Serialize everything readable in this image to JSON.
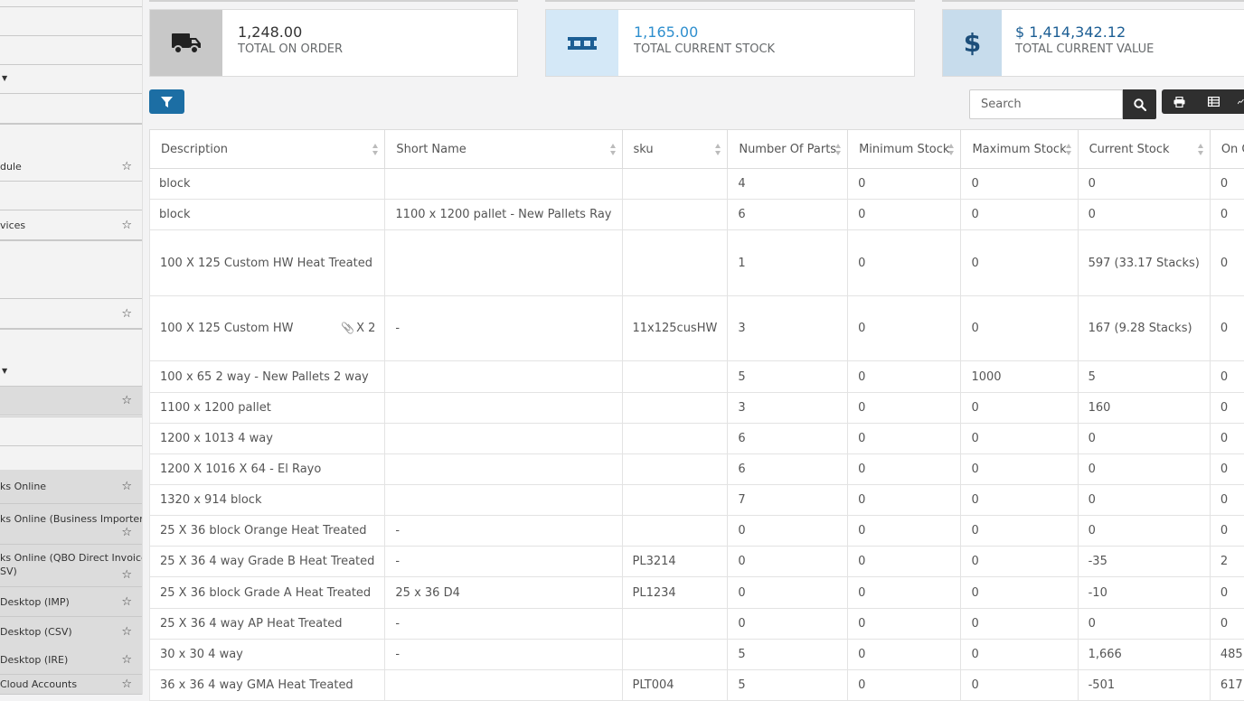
{
  "sidebar": {
    "items": [
      {
        "label": "",
        "star": false,
        "caret": false,
        "dark": false
      },
      {
        "label": "",
        "star": false,
        "caret": false,
        "dark": false
      },
      {
        "label": "",
        "star": false,
        "caret": false,
        "dark": false
      },
      {
        "label": "",
        "star": false,
        "caret": true,
        "dark": false
      },
      {
        "label": "",
        "star": false,
        "caret": false,
        "dark": false
      },
      {
        "label": "dule",
        "star": true,
        "caret": false,
        "dark": false
      },
      {
        "label": "",
        "star": false,
        "caret": false,
        "dark": false
      },
      {
        "label": "vices",
        "star": true,
        "caret": false,
        "dark": false
      },
      {
        "label": "",
        "star": false,
        "caret": false,
        "dark": false
      },
      {
        "label": "",
        "star": true,
        "caret": false,
        "dark": false
      },
      {
        "label": "",
        "star": false,
        "caret": true,
        "dark": false
      },
      {
        "label": "",
        "star": true,
        "caret": false,
        "dark": true
      },
      {
        "label": "ks Online",
        "star": true,
        "caret": false,
        "dark": true
      },
      {
        "label": "ks Online (Business Importer -",
        "star": true,
        "caret": false,
        "dark": true
      },
      {
        "label": "ks Online (QBO Direct Invoice",
        "label2": "SV)",
        "star": true,
        "caret": false,
        "dark": true
      },
      {
        "label": "Desktop (IMP)",
        "star": true,
        "caret": false,
        "dark": true
      },
      {
        "label": "Desktop (CSV)",
        "star": true,
        "caret": false,
        "dark": true
      },
      {
        "label": "Desktop (IRE)",
        "star": true,
        "caret": false,
        "dark": true
      },
      {
        "label": "Cloud Accounts",
        "star": true,
        "caret": false,
        "dark": true
      }
    ]
  },
  "cards": [
    {
      "value": "1,248.00",
      "label": "TOTAL ON ORDER",
      "icon": "truck-icon",
      "value_color": "#333333",
      "icon_bg": "#c8c8c8"
    },
    {
      "value": "1,165.00",
      "label": "TOTAL CURRENT STOCK",
      "icon": "pallet-icon",
      "value_color": "#2f8fce",
      "icon_bg": "#d4e8f7"
    },
    {
      "value": "$ 1,414,342.12",
      "label": "TOTAL CURRENT VALUE",
      "icon": "dollar-icon",
      "value_color": "#1c5e94",
      "icon_bg": "#c7dcec"
    }
  ],
  "toolbar": {
    "search_placeholder": "Search"
  },
  "table": {
    "columns": [
      "Description",
      "Short Name",
      "sku",
      "Number Of Parts",
      "Minimum Stock",
      "Maximum Stock",
      "Current Stock",
      "On Order"
    ],
    "rows": [
      {
        "description": "block",
        "short_name": "",
        "sku": "",
        "parts": "4",
        "min": "0",
        "max": "0",
        "current": "0",
        "on_order": "0"
      },
      {
        "description": "block",
        "short_name": "1100 x 1200 pallet - New Pallets Ray",
        "sku": "",
        "parts": "6",
        "min": "0",
        "max": "0",
        "current": "0",
        "on_order": "0"
      },
      {
        "description": "100 X 125 Custom HW Heat Treated",
        "short_name": "",
        "sku": "",
        "parts": "1",
        "min": "0",
        "max": "0",
        "current": "597 (33.17 Stacks)",
        "on_order": "0"
      },
      {
        "description": "100 X 125 Custom HW",
        "attachments": "X 2",
        "short_name": "-",
        "sku": "11x125cusHW",
        "parts": "3",
        "min": "0",
        "max": "0",
        "current": "167 (9.28 Stacks)",
        "on_order": "0"
      },
      {
        "description": "100 x 65 2 way - New Pallets 2 way",
        "short_name": "",
        "sku": "",
        "parts": "5",
        "min": "0",
        "max": "1000",
        "current": "5",
        "on_order": "0"
      },
      {
        "description": "1100 x 1200 pallet",
        "short_name": "",
        "sku": "",
        "parts": "3",
        "min": "0",
        "max": "0",
        "current": "160",
        "on_order": "0"
      },
      {
        "description": "1200 x 1013 4 way",
        "short_name": "",
        "sku": "",
        "parts": "6",
        "min": "0",
        "max": "0",
        "current": "0",
        "on_order": "0"
      },
      {
        "description": "1200 X 1016 X 64 - El Rayo",
        "short_name": "",
        "sku": "",
        "parts": "6",
        "min": "0",
        "max": "0",
        "current": "0",
        "on_order": "0"
      },
      {
        "description": "1320 x 914 block",
        "short_name": "",
        "sku": "",
        "parts": "7",
        "min": "0",
        "max": "0",
        "current": "0",
        "on_order": "0"
      },
      {
        "description": "25 X 36 block Orange Heat Treated",
        "short_name": "-",
        "sku": "",
        "parts": "0",
        "min": "0",
        "max": "0",
        "current": "0",
        "on_order": "0"
      },
      {
        "description": "25 X 36 4 way Grade B Heat Treated",
        "short_name": "-",
        "sku": "PL3214",
        "parts": "0",
        "min": "0",
        "max": "0",
        "current": "-35",
        "on_order": "2"
      },
      {
        "description": "25 X 36 block Grade A Heat Treated",
        "short_name": "25 x 36 D4",
        "sku": "PL1234",
        "parts": "0",
        "min": "0",
        "max": "0",
        "current": "-10",
        "on_order": "0"
      },
      {
        "description": "25 X 36 4 way AP Heat Treated",
        "short_name": "-",
        "sku": "",
        "parts": "0",
        "min": "0",
        "max": "0",
        "current": "0",
        "on_order": "0"
      },
      {
        "description": "30 x 30 4 way",
        "short_name": "-",
        "sku": "",
        "parts": "5",
        "min": "0",
        "max": "0",
        "current": "1,666",
        "on_order": "485"
      },
      {
        "description": "36 x 36 4 way GMA Heat Treated",
        "short_name": "",
        "sku": "PLT004",
        "parts": "5",
        "min": "0",
        "max": "0",
        "current": "-501",
        "on_order": "617"
      }
    ]
  }
}
